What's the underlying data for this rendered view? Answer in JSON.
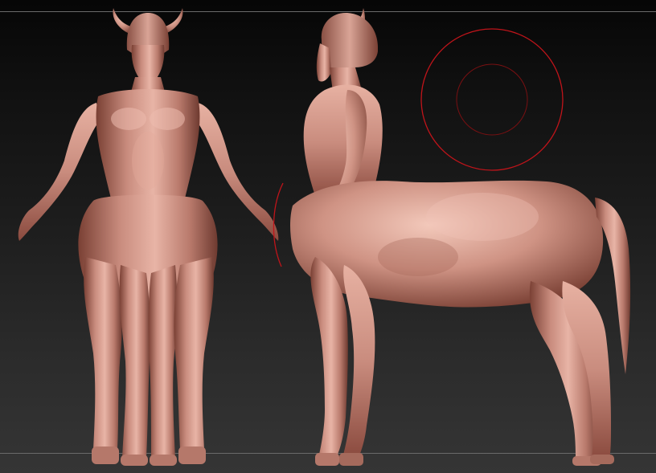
{
  "viewport": {
    "background_top": "#060606",
    "background_bottom": "#353535",
    "border_color": "#6a6a6a"
  },
  "model": {
    "skin_color": "#c98c7e",
    "skin_highlight": "#f0c4b6",
    "skin_shadow": "#6e3a30"
  },
  "brush_cursor": {
    "color": "#c0141a"
  }
}
